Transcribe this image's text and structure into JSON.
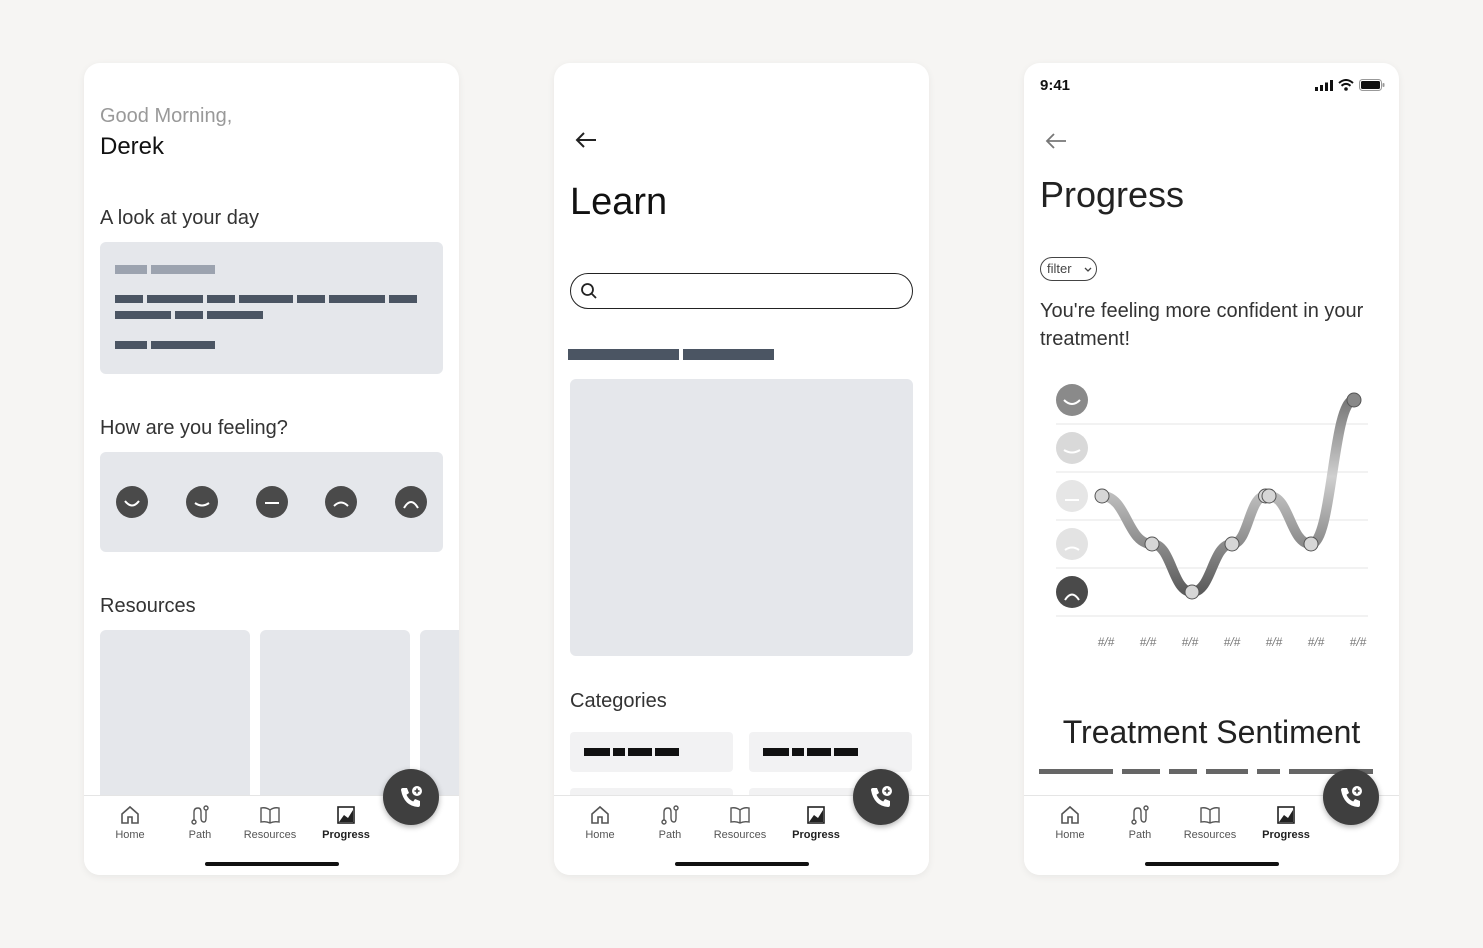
{
  "home": {
    "greeting": "Good Morning,",
    "name": "Derek",
    "day_heading": "A look at your day",
    "feeling_heading": "How are you feeling?",
    "resources_heading": "Resources"
  },
  "learn": {
    "title": "Learn",
    "search_placeholder": "",
    "categories_heading": "Categories"
  },
  "progress": {
    "status_time": "9:41",
    "title": "Progress",
    "filter_label": "filter",
    "insight": "You're feeling more confident in your treatment!",
    "section_title": "Treatment Sentiment",
    "x_ticks": [
      "#/#",
      "#/#",
      "#/#",
      "#/#",
      "#/#",
      "#/#",
      "#/#"
    ]
  },
  "chart_data": {
    "type": "line",
    "x": [
      "#/#",
      "#/#",
      "#/#",
      "#/#",
      "#/#",
      "#/#",
      "#/#"
    ],
    "y_levels": [
      "very happy",
      "happy",
      "neutral",
      "sad",
      "very sad"
    ],
    "values": [
      3,
      2,
      1,
      2,
      3,
      2,
      5
    ],
    "extra_points": [
      {
        "after_index": 3,
        "value": 3
      }
    ],
    "ylim": [
      1,
      5
    ],
    "grid": true
  },
  "nav": {
    "items": [
      {
        "label": "Home",
        "icon": "home-icon"
      },
      {
        "label": "Path",
        "icon": "path-icon"
      },
      {
        "label": "Resources",
        "icon": "book-icon"
      },
      {
        "label": "Progress",
        "icon": "chart-icon"
      }
    ]
  },
  "colors": {
    "card_gray": "#e5e7eb",
    "dark_bar": "#4b5563",
    "fab": "#3f3f3f"
  }
}
